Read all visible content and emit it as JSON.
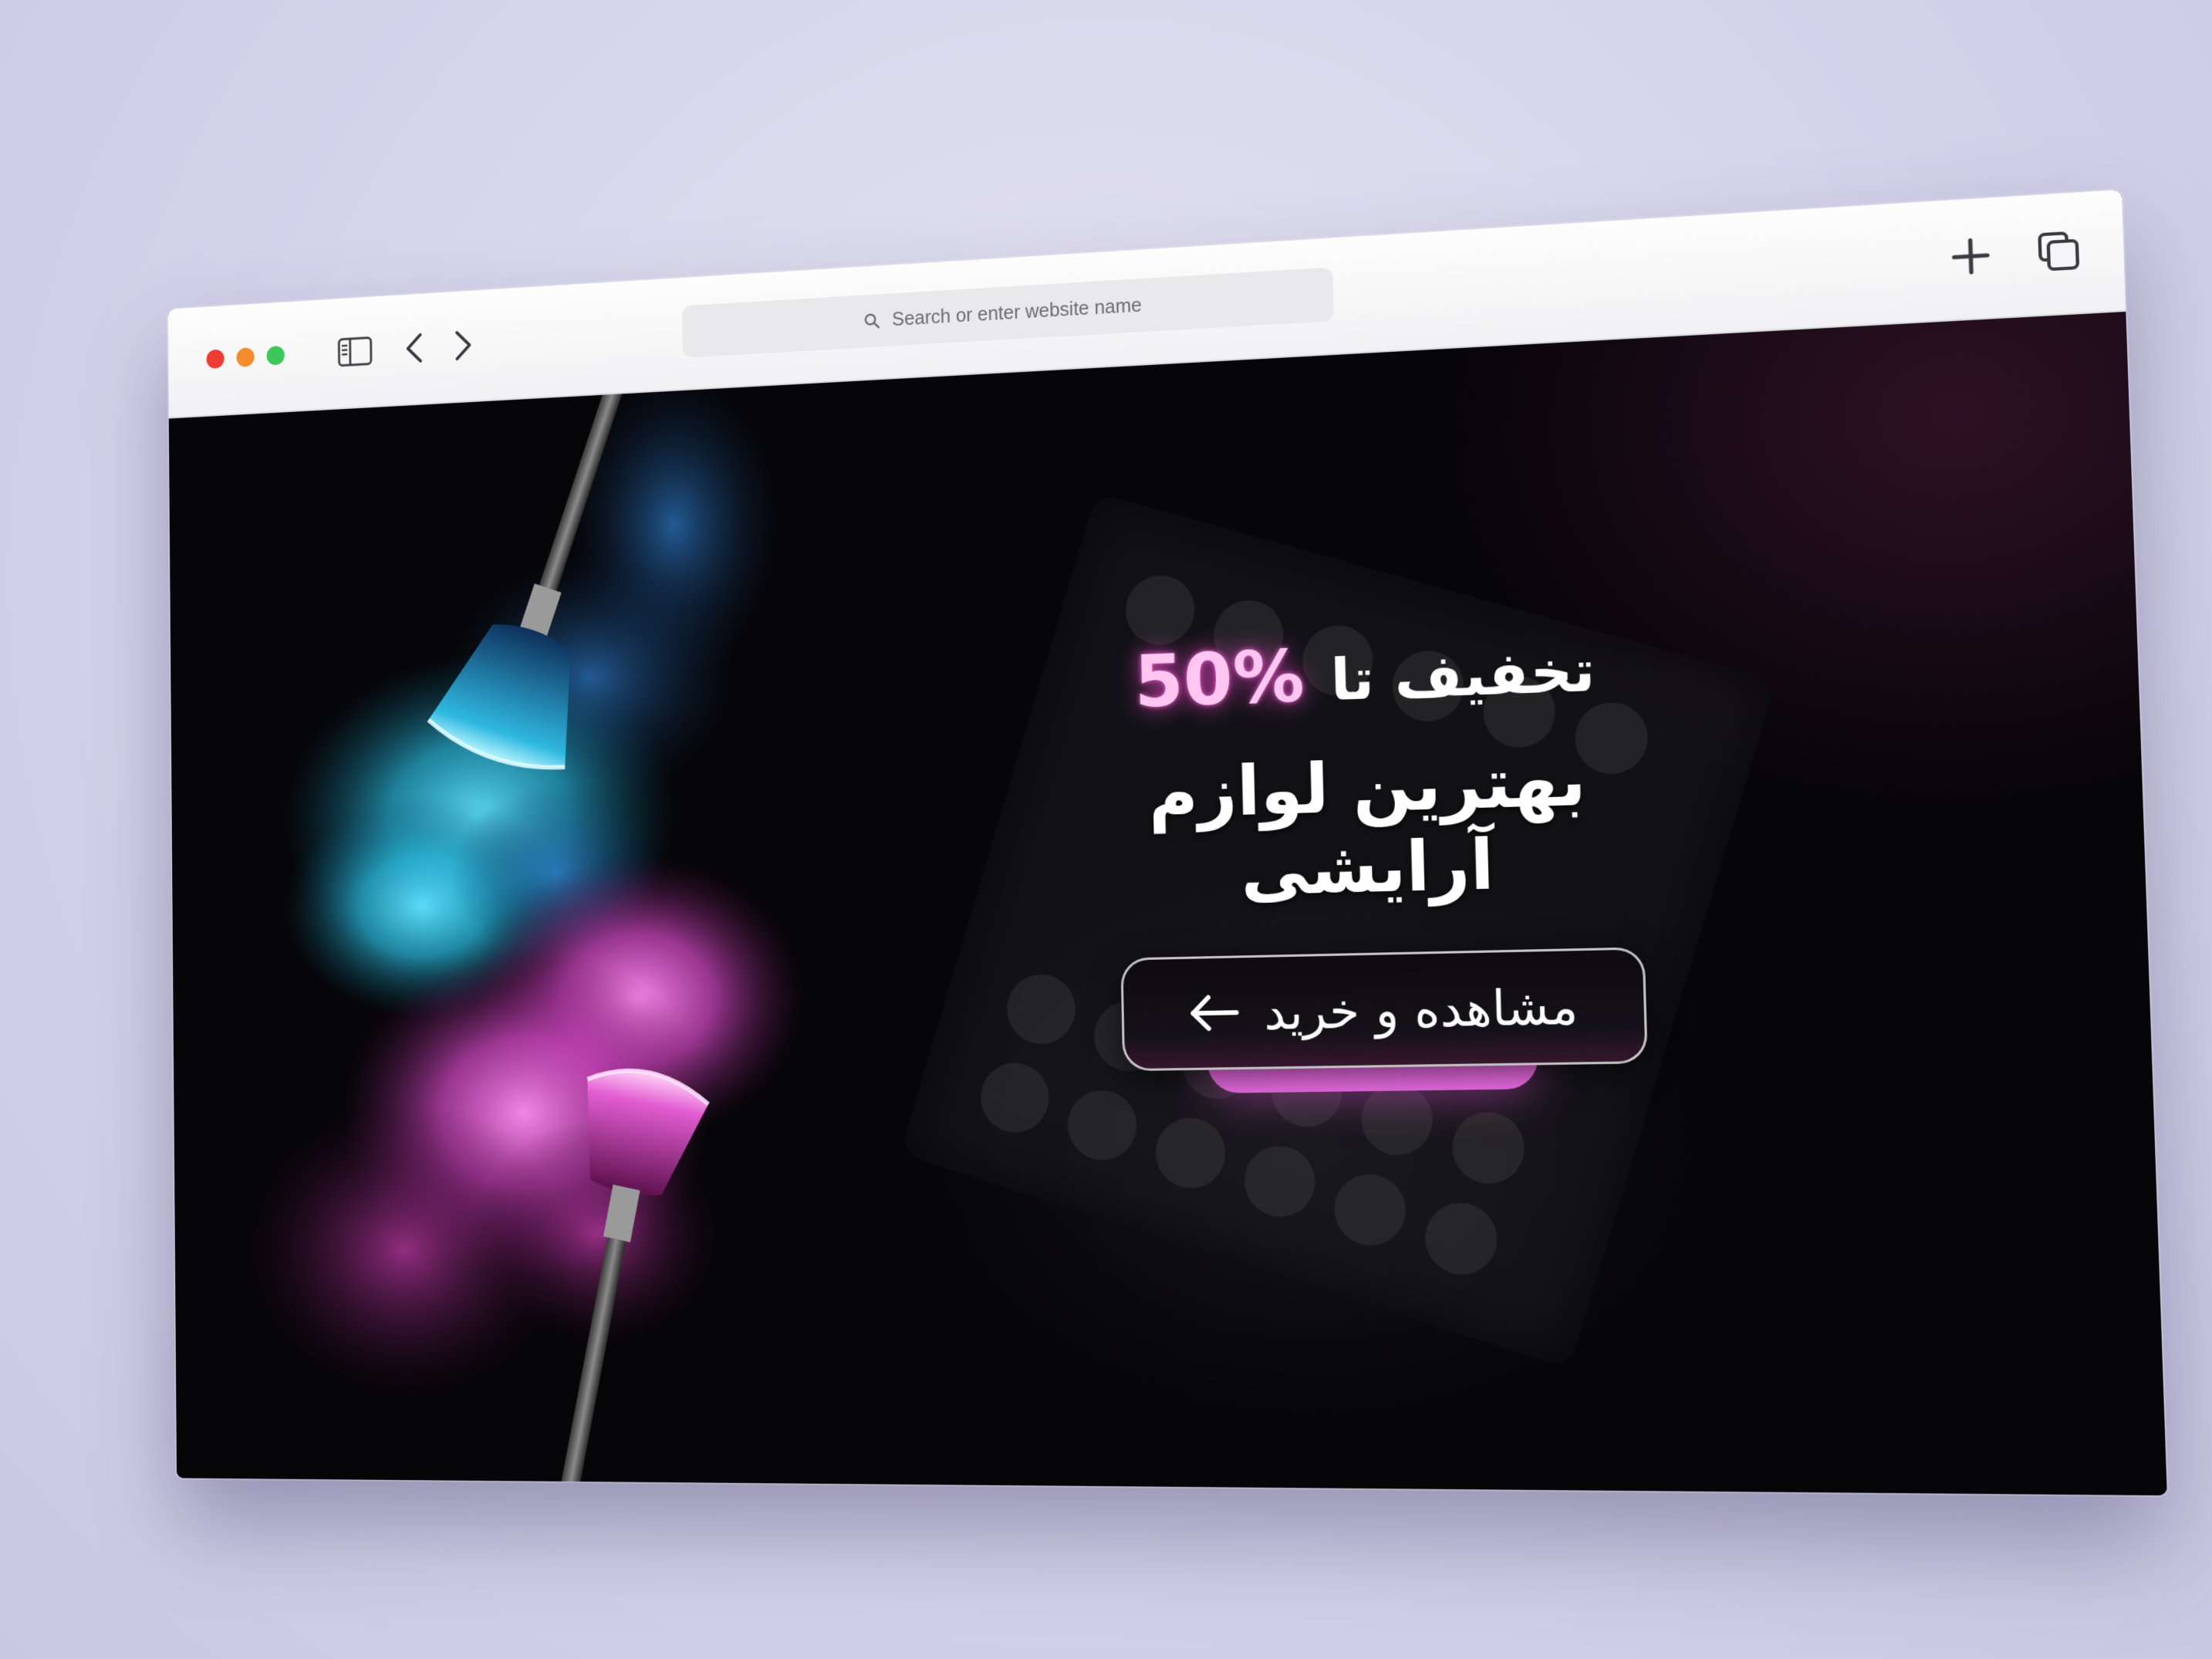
{
  "browser": {
    "address_placeholder": "Search or enter website name",
    "icons": {
      "close": "close-dot",
      "minimize": "minimize-dot",
      "maximize": "maximize-dot",
      "sidebar": "sidebar-icon",
      "back": "chevron-left-icon",
      "forward": "chevron-right-icon",
      "search": "search-icon",
      "new_tab": "plus-icon",
      "tabs": "tabs-icon"
    },
    "colors": {
      "toolbar": "#f5f5f7",
      "close": "#ee3b35",
      "minimize": "#f38b2f",
      "maximize": "#3bc85a"
    }
  },
  "hero": {
    "discount_label": "تخفیف تا",
    "discount_value": "50%",
    "headline": "بهترین لوازم آرایشی",
    "cta_label": "مشاهده و خرید",
    "cta_icon": "arrow-left-icon",
    "colors": {
      "background": "#060507",
      "accent": "#f06ee9",
      "powder_blue": "#35c7e6",
      "powder_pink": "#e24fd0"
    }
  }
}
